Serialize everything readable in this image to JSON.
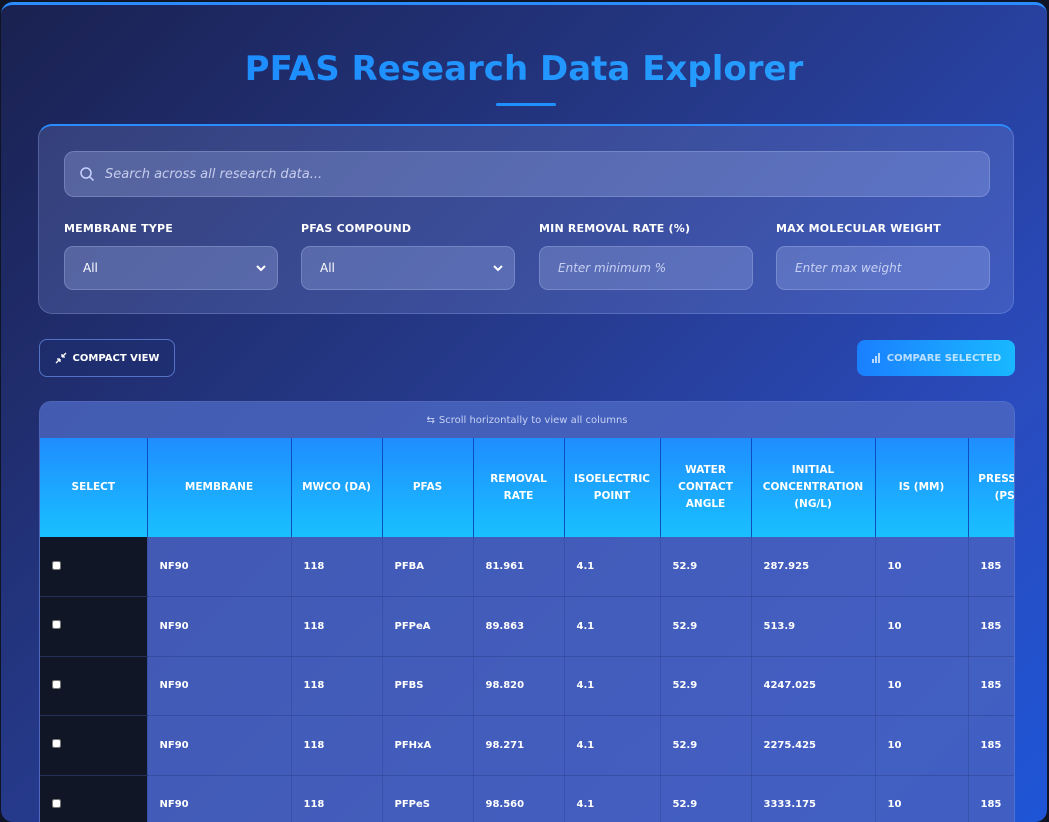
{
  "header": {
    "title": "PFAS Research Data Explorer"
  },
  "search": {
    "placeholder": "Search across all research data..."
  },
  "filters": [
    {
      "label": "MEMBRANE TYPE",
      "type": "select",
      "value": "All"
    },
    {
      "label": "PFAS COMPOUND",
      "type": "select",
      "value": "All"
    },
    {
      "label": "MIN REMOVAL RATE (%)",
      "type": "input",
      "placeholder": "Enter minimum %"
    },
    {
      "label": "MAX MOLECULAR WEIGHT",
      "type": "input",
      "placeholder": "Enter max weight"
    }
  ],
  "actions": {
    "compact_label": "COMPACT VIEW",
    "compare_label": "COMPARE SELECTED"
  },
  "table": {
    "scroll_hint": "Scroll horizontally to view all columns",
    "columns": [
      "SELECT",
      "MEMBRANE",
      "MWCO (DA)",
      "PFAS",
      "REMOVAL RATE",
      "ISOELECTRIC POINT",
      "WATER CONTACT ANGLE",
      "INITIAL CONCENTRATION (NG/L)",
      "IS (MM)",
      "PRESSURE (PSI)"
    ],
    "rows": [
      [
        "NF90",
        "118",
        "PFBA",
        "81.961",
        "4.1",
        "52.9",
        "287.925",
        "10",
        "185"
      ],
      [
        "NF90",
        "118",
        "PFPeA",
        "89.863",
        "4.1",
        "52.9",
        "513.9",
        "10",
        "185"
      ],
      [
        "NF90",
        "118",
        "PFBS",
        "98.820",
        "4.1",
        "52.9",
        "4247.025",
        "10",
        "185"
      ],
      [
        "NF90",
        "118",
        "PFHxA",
        "98.271",
        "4.1",
        "52.9",
        "2275.425",
        "10",
        "185"
      ],
      [
        "NF90",
        "118",
        "PFPeS",
        "98.560",
        "4.1",
        "52.9",
        "3333.175",
        "10",
        "185"
      ]
    ]
  },
  "colors": {
    "accent": "#1e90ff",
    "header_cyan": "#19c0ff",
    "bg_dark": "#1a2150"
  }
}
